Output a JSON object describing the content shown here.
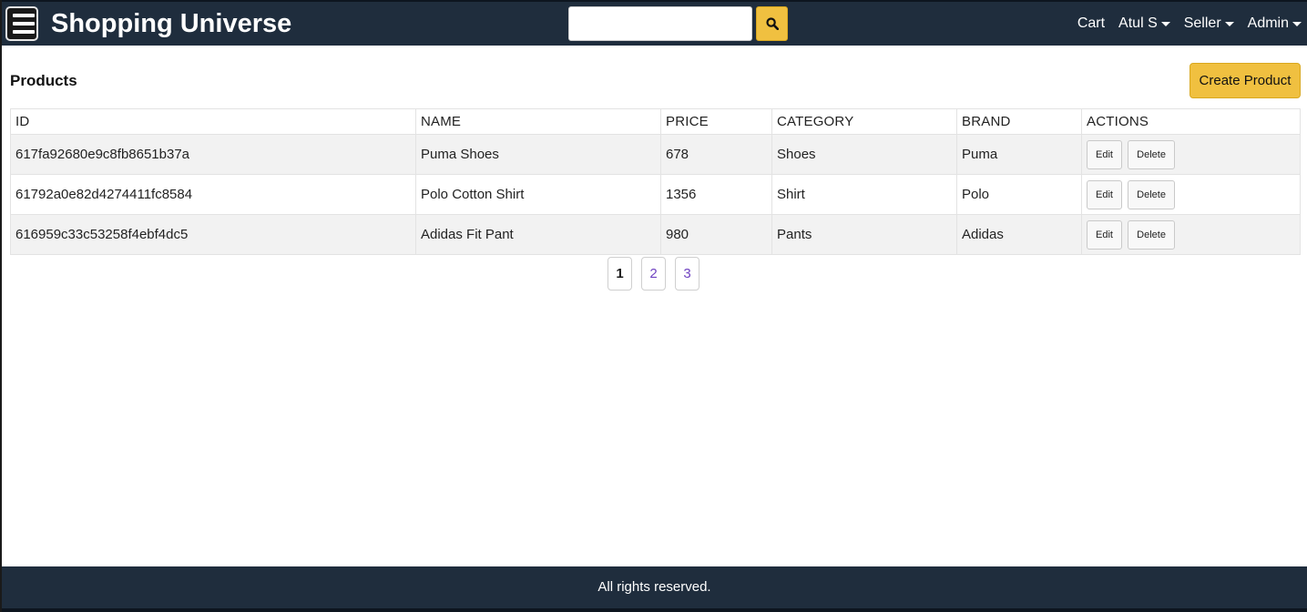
{
  "header": {
    "brand": "Shopping Universe",
    "search": {
      "value": "",
      "placeholder": ""
    },
    "nav": [
      {
        "label": "Cart",
        "dropdown": false
      },
      {
        "label": "Atul S",
        "dropdown": true
      },
      {
        "label": "Seller",
        "dropdown": true
      },
      {
        "label": "Admin",
        "dropdown": true
      }
    ]
  },
  "main": {
    "title": "Products",
    "create_button": "Create Product",
    "table": {
      "columns": [
        "ID",
        "NAME",
        "PRICE",
        "CATEGORY",
        "BRAND",
        "ACTIONS"
      ],
      "rows": [
        {
          "id": "617fa92680e9c8fb8651b37a",
          "name": "Puma Shoes",
          "price": "678",
          "category": "Shoes",
          "brand": "Puma"
        },
        {
          "id": "61792a0e82d4274411fc8584",
          "name": "Polo Cotton Shirt",
          "price": "1356",
          "category": "Shirt",
          "brand": "Polo"
        },
        {
          "id": "616959c33c53258f4ebf4dc5",
          "name": "Adidas Fit Pant",
          "price": "980",
          "category": "Pants",
          "brand": "Adidas"
        }
      ],
      "edit_label": "Edit",
      "delete_label": "Delete"
    },
    "pagination": {
      "pages": [
        "1",
        "2",
        "3"
      ],
      "current": "1"
    }
  },
  "footer": {
    "text": "All rights reserved."
  },
  "colors": {
    "navbar_bg": "#1f2d3d",
    "accent": "#f0c040",
    "page_link": "#6f42c1"
  },
  "icons": {
    "menu": "hamburger-menu-icon",
    "search": "search-icon",
    "dropdown": "caret-down-icon"
  }
}
